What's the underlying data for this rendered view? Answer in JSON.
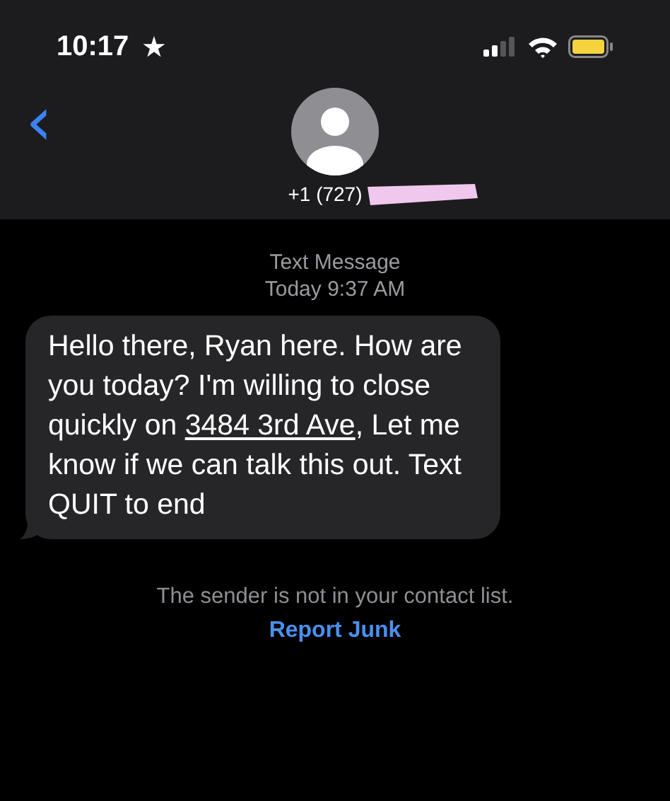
{
  "status_bar": {
    "time": "10:17",
    "star": "★"
  },
  "header": {
    "back": "‹",
    "contact": "+1 (727)",
    "redacted": true
  },
  "thread": {
    "service": "Text Message",
    "timestamp": "Today 9:37 AM"
  },
  "message": {
    "parts": [
      {
        "kind": "text",
        "text": "Hello there, Ryan here. How are you today? I'm willing to close quickly on "
      },
      {
        "kind": "link",
        "text": "3484 3rd Ave"
      },
      {
        "kind": "text",
        "text": ", Let me know if we can talk this out. Text QUIT to end"
      }
    ]
  },
  "notice": {
    "text": "The sender is not in your contact list.",
    "action": "Report Junk"
  }
}
